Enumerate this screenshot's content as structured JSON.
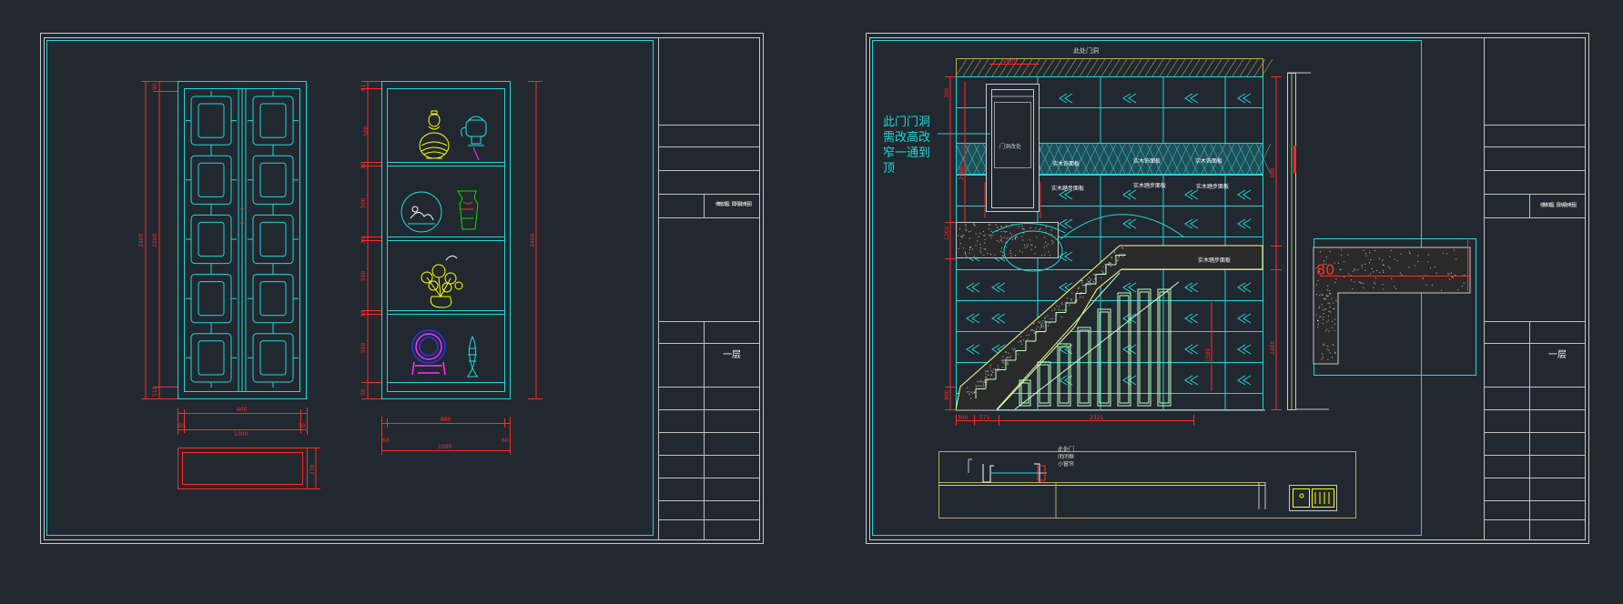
{
  "colors": {
    "background": "#212830",
    "frame": "#c8c8c8",
    "cyan": "#20d8d8",
    "red": "#ff2a2a",
    "yellow": "#ffff00",
    "green": "#00e000",
    "blue": "#3030ff",
    "magenta": "#ff30ff",
    "olive": "#b8b050"
  },
  "sheet1": {
    "title_block_text": "佛龛详图、屏风 展示柜图",
    "sheet_label": "一层",
    "screen_dims": {
      "height_total": "2400",
      "height_inner": "2200",
      "top": "90",
      "bottom": "110",
      "width_inner": "900",
      "width_total": "1000",
      "side_left": "50",
      "side_right": "50",
      "plan_depth": "270"
    },
    "cabinet_dims": {
      "height_total": "2400",
      "top": "61",
      "seg1": "500",
      "shelf1": "30",
      "seg2": "500",
      "shelf2": "30",
      "seg3": "500",
      "shelf3": "30",
      "seg4": "500",
      "bottom": "30",
      "width_inner": "880",
      "width_total": "1000",
      "side_left": "60",
      "side_right": "60"
    }
  },
  "sheet2": {
    "title_block_text": "楼梯详图、厨房 展示柜图",
    "sheet_label": "一层",
    "top_label": "此处门洞",
    "note_lines": [
      "此门门洞",
      "需改高改",
      "窄一通到",
      "顶"
    ],
    "door_label": "门洞改处",
    "tile_labels": [
      "实木饰面板",
      "实木饰面板",
      "实木饰面板"
    ],
    "row_labels": [
      "实木踏步面板",
      "实木踏步面板",
      "实木踏步面板"
    ],
    "stair_label": "实木踏步面板",
    "detail_big_dim": "80",
    "dims": {
      "top_width": "1000",
      "left_a": "300",
      "left_b": "2400",
      "left_c": "1200",
      "left_d": "900",
      "right_a": "300",
      "right_b": "2400",
      "bottom_a": "300",
      "bottom_b": "571",
      "bottom_c": "2321",
      "under_stair": "1500"
    },
    "plan_labels": [
      "此处门",
      "闭闭框",
      "小窗帘"
    ]
  }
}
